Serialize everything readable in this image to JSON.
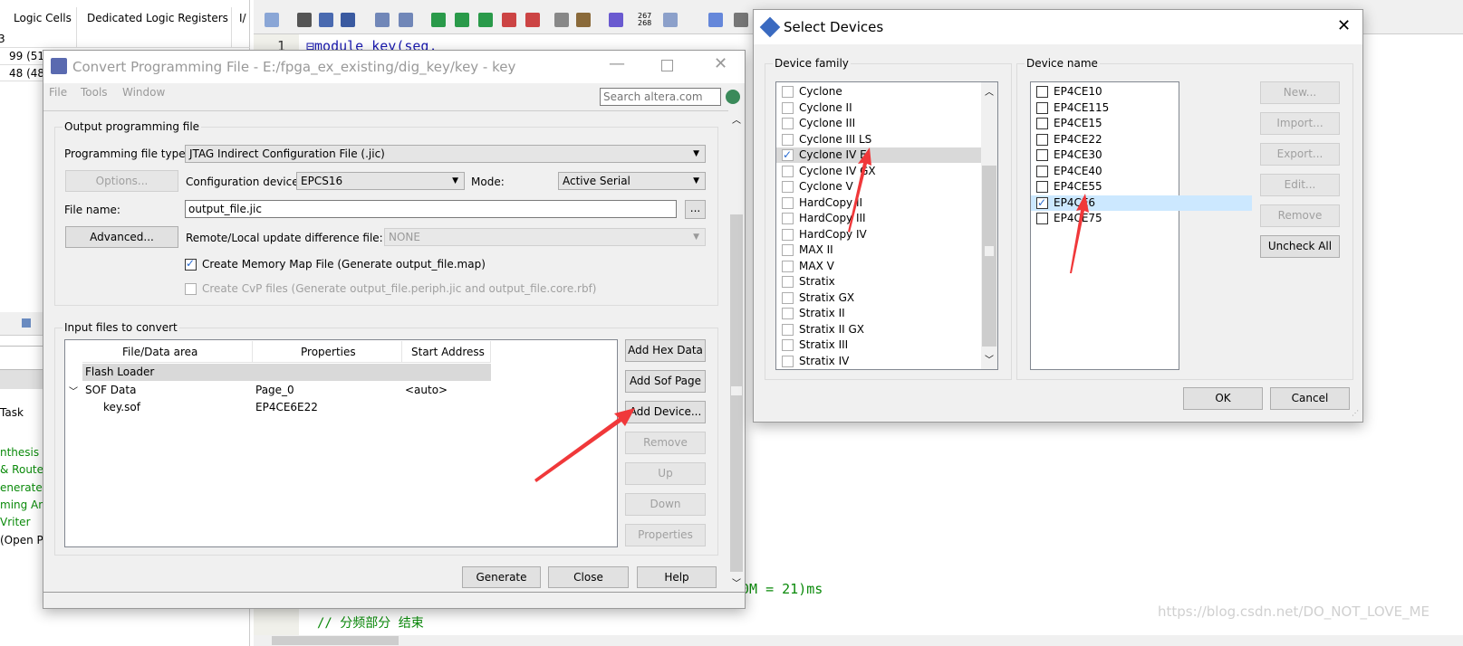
{
  "background": {
    "table_headers": [
      "Logic Cells",
      "Dedicated Logic Registers",
      "I/"
    ],
    "row_prefix": "3",
    "rows": [
      "99 (51",
      "48 (48"
    ],
    "task_header": "Task",
    "tasks": [
      "nthesis",
      "& Route)",
      "enerate",
      "ming An",
      "Vriter",
      "(Open P"
    ],
    "editor": {
      "line_number": "1",
      "code_line": "⊟module key(seg,",
      "bottom_code": "0M = 21)ms",
      "bottom_comment": "// 分频部分 结束",
      "toolbar_numbers": "267\n268"
    },
    "watermark": "https://blog.csdn.net/DO_NOT_LOVE_ME"
  },
  "convert": {
    "title": "Convert Programming File - E:/fpga_ex_existing/dig_key/key - key",
    "menu": [
      "File",
      "Tools",
      "Window"
    ],
    "search_placeholder": "Search altera.com",
    "output_group": "Output programming file",
    "file_type_label": "Programming file type:",
    "file_type_value": "JTAG Indirect Configuration File (.jic)",
    "options_button": "Options...",
    "config_device_label": "Configuration device:",
    "config_device_value": "EPCS16",
    "mode_label": "Mode:",
    "mode_value": "Active Serial",
    "file_name_label": "File name:",
    "file_name_value": "output_file.jic",
    "browse_button": "...",
    "advanced_button": "Advanced...",
    "remote_label": "Remote/Local update difference file:",
    "remote_value": "NONE",
    "memory_map_label": "Create Memory Map File (Generate output_file.map)",
    "memory_map_checked": true,
    "cvp_label": "Create CvP files (Generate output_file.periph.jic and output_file.core.rbf)",
    "cvp_checked": false,
    "input_group": "Input files to convert",
    "columns": [
      "File/Data area",
      "Properties",
      "Start Address"
    ],
    "flash_loader": "Flash Loader",
    "sof_row": {
      "name": "SOF Data",
      "properties": "Page_0",
      "address": "<auto>"
    },
    "file_row": {
      "name": "key.sof",
      "properties": "EP4CE6E22"
    },
    "side_buttons": [
      {
        "label": "Add Hex Data",
        "enabled": true
      },
      {
        "label": "Add Sof Page",
        "enabled": true
      },
      {
        "label": "Add Device...",
        "enabled": true
      },
      {
        "label": "Remove",
        "enabled": false
      },
      {
        "label": "Up",
        "enabled": false
      },
      {
        "label": "Down",
        "enabled": false
      },
      {
        "label": "Properties",
        "enabled": false
      }
    ],
    "generate_button": "Generate",
    "close_button": "Close",
    "help_button": "Help"
  },
  "select_devices": {
    "title": "Select Devices",
    "family_group": "Device family",
    "families": [
      {
        "label": "Cyclone",
        "checked": false
      },
      {
        "label": "Cyclone II",
        "checked": false
      },
      {
        "label": "Cyclone III",
        "checked": false
      },
      {
        "label": "Cyclone III LS",
        "checked": false
      },
      {
        "label": "Cyclone IV E",
        "checked": true
      },
      {
        "label": "Cyclone IV GX",
        "checked": false
      },
      {
        "label": "Cyclone V",
        "checked": false
      },
      {
        "label": "HardCopy II",
        "checked": false
      },
      {
        "label": "HardCopy III",
        "checked": false
      },
      {
        "label": "HardCopy IV",
        "checked": false
      },
      {
        "label": "MAX II",
        "checked": false
      },
      {
        "label": "MAX V",
        "checked": false
      },
      {
        "label": "Stratix",
        "checked": false
      },
      {
        "label": "Stratix GX",
        "checked": false
      },
      {
        "label": "Stratix II",
        "checked": false
      },
      {
        "label": "Stratix II GX",
        "checked": false
      },
      {
        "label": "Stratix III",
        "checked": false
      },
      {
        "label": "Stratix IV",
        "checked": false
      }
    ],
    "name_group": "Device name",
    "devices": [
      {
        "label": "EP4CE10",
        "checked": false
      },
      {
        "label": "EP4CE115",
        "checked": false
      },
      {
        "label": "EP4CE15",
        "checked": false
      },
      {
        "label": "EP4CE22",
        "checked": false
      },
      {
        "label": "EP4CE30",
        "checked": false
      },
      {
        "label": "EP4CE40",
        "checked": false
      },
      {
        "label": "EP4CE55",
        "checked": false
      },
      {
        "label": "EP4CE6",
        "checked": true
      },
      {
        "label": "EP4CE75",
        "checked": false
      }
    ],
    "side_buttons": [
      {
        "label": "New...",
        "enabled": false
      },
      {
        "label": "Import...",
        "enabled": false
      },
      {
        "label": "Export...",
        "enabled": false
      },
      {
        "label": "Edit...",
        "enabled": false
      },
      {
        "label": "Remove",
        "enabled": false
      },
      {
        "label": "Uncheck All",
        "enabled": true
      }
    ],
    "ok_button": "OK",
    "cancel_button": "Cancel"
  },
  "colors": {
    "annotation_arrow": "#f0383a",
    "selection_blue": "#cce8ff",
    "dialog_bg": "#f0f0f0",
    "task_green": "#0a8a0a"
  }
}
